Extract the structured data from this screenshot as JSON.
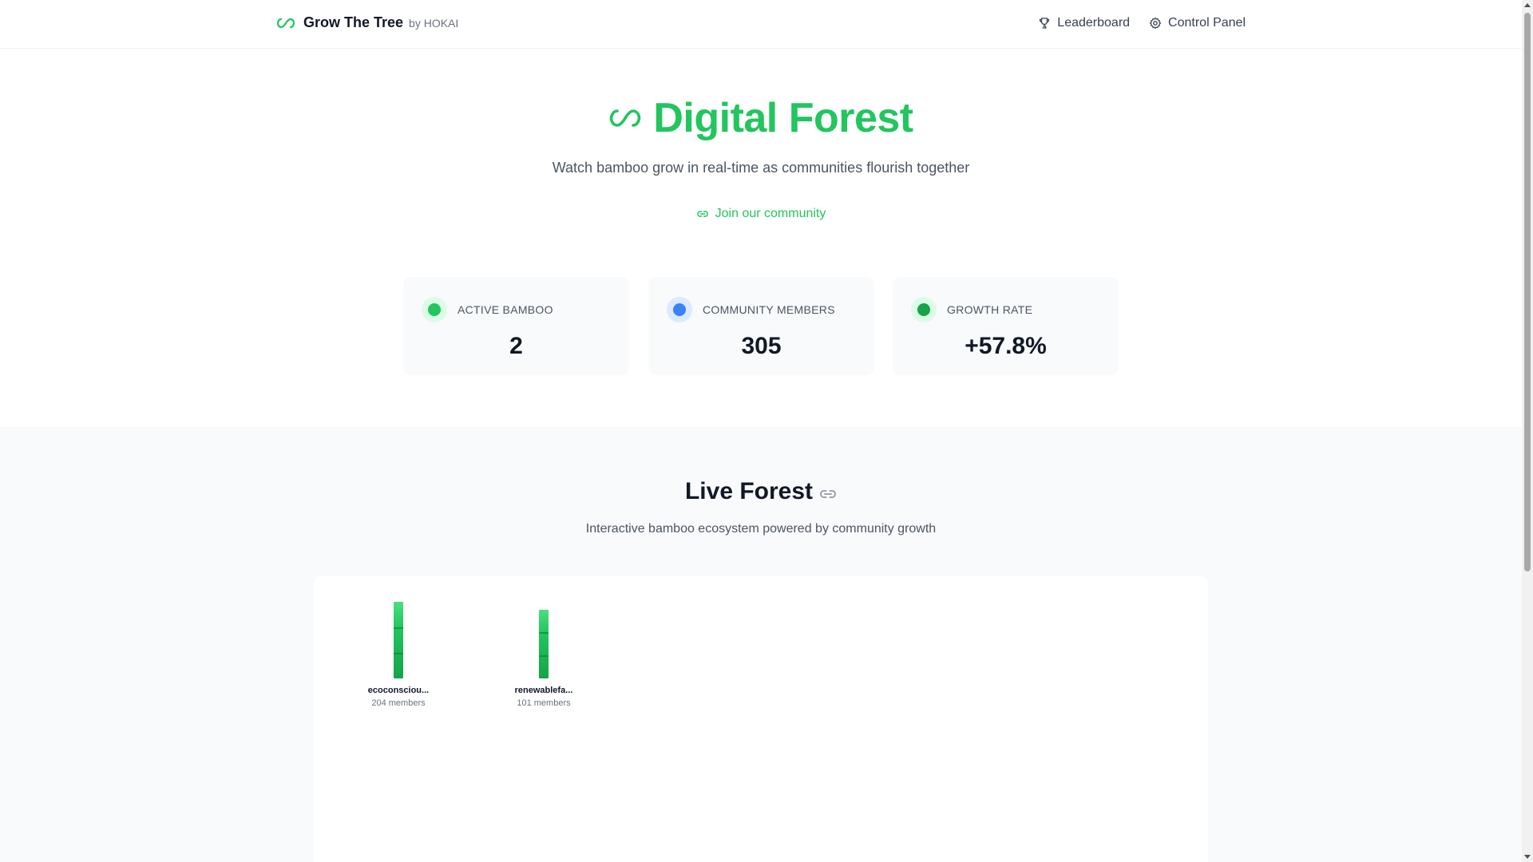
{
  "header": {
    "brand_name": "Grow The Tree",
    "brand_by": "by HOKAI",
    "nav": [
      {
        "label": "Leaderboard",
        "icon": "trophy-icon"
      },
      {
        "label": "Control Panel",
        "icon": "gear-icon"
      }
    ]
  },
  "hero": {
    "title": "Digital Forest",
    "subtitle": "Watch bamboo grow in real-time as communities flourish together",
    "join_label": "Join our community"
  },
  "stats": [
    {
      "label": "ACTIVE BAMBOO",
      "value": "2",
      "dot_color": "#22c55e",
      "ring_color": "#dcfce7"
    },
    {
      "label": "COMMUNITY MEMBERS",
      "value": "305",
      "dot_color": "#3b82f6",
      "ring_color": "#dbeafe"
    },
    {
      "label": "GROWTH RATE",
      "value": "+57.8%",
      "dot_color": "#16a34a",
      "ring_color": "#dcfce7"
    }
  ],
  "forest": {
    "title": "Live Forest",
    "subtitle": "Interactive bamboo ecosystem powered by community growth",
    "bamboo": [
      {
        "name": "ecoconsciou...",
        "members_label": "204 members",
        "members": 204
      },
      {
        "name": "renewablefa...",
        "members_label": "101 members",
        "members": 101
      }
    ]
  },
  "colors": {
    "accent": "#22c55e",
    "accent_dark": "#16a34a",
    "blue": "#3b82f6"
  }
}
